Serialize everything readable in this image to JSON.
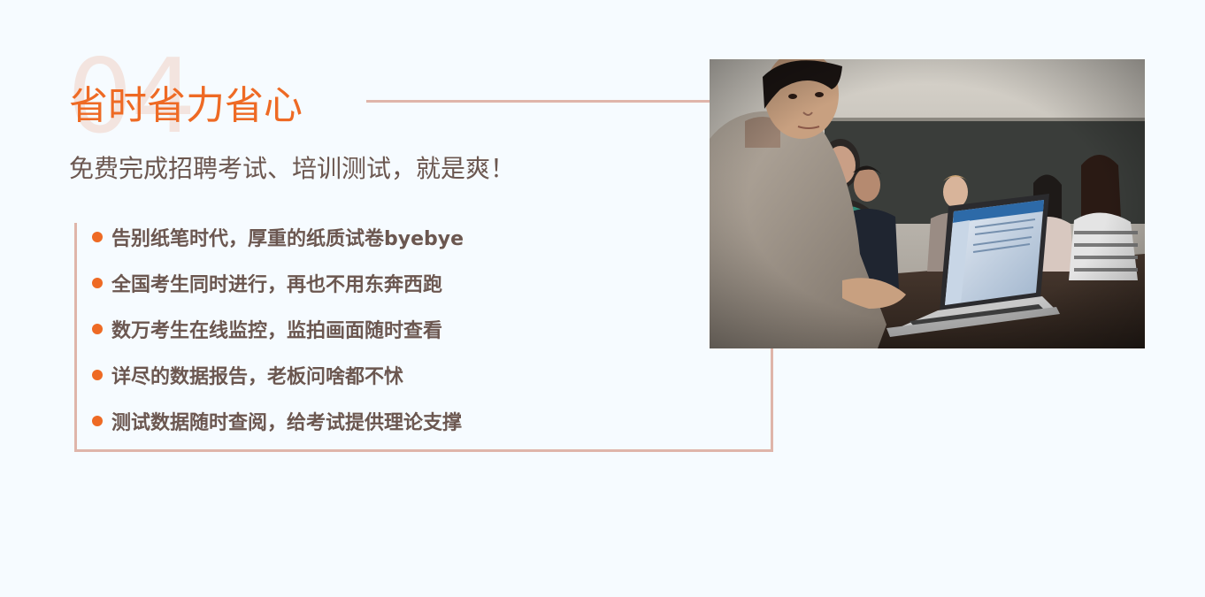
{
  "section": {
    "number": "04",
    "title": "省时省力省心",
    "subtitle": "免费完成招聘考试、培训测试，就是爽！"
  },
  "features": [
    "告别纸笔时代，厚重的纸质试卷byebye",
    "全国考生同时进行，再也不用东奔西跑",
    "数万考生在线监控，监拍画面随时查看",
    "详尽的数据报告，老板问啥都不怵",
    "测试数据随时查阅，给考试提供理论支撑"
  ],
  "colors": {
    "accent": "#ee6a24",
    "text": "#6b5750",
    "frame": "#dfb5aa",
    "background": "#f6fbff"
  }
}
